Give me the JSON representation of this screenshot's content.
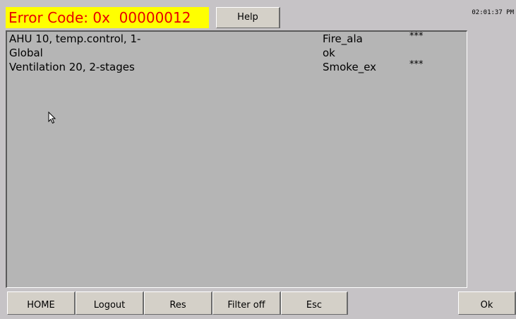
{
  "header": {
    "error_code": "Error Code: 0x  00000012",
    "help_label": "Help",
    "clock": "02:01:37 PM"
  },
  "alarms": [
    {
      "name": "AHU 10, temp.control, 1-",
      "state": "Fire_ala",
      "stars": "***"
    },
    {
      "name": "Global",
      "state": "ok",
      "stars": ""
    },
    {
      "name": "Ventilation 20, 2-stages",
      "state": "Smoke_ex",
      "stars": "***"
    }
  ],
  "footer": {
    "home": "HOME",
    "logout": "Logout",
    "res": "Res",
    "filter": "Filter off",
    "esc": "Esc",
    "ok": "Ok"
  },
  "colors": {
    "error_bg": "#ffff00",
    "error_text": "#e80000",
    "background": "#c6c3c6",
    "panel": "#b5b5b5"
  }
}
